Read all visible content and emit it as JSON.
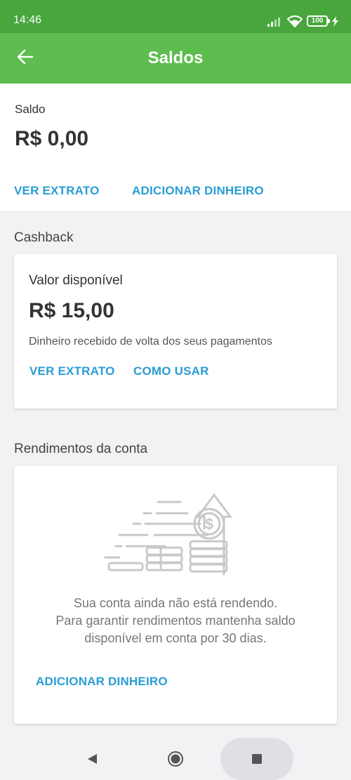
{
  "status_bar": {
    "time": "14:46",
    "battery": "100",
    "icons": [
      "signal-icon",
      "wifi-icon",
      "battery-icon",
      "charging-icon"
    ]
  },
  "app_bar": {
    "title": "Saldos",
    "back_icon": "arrow-left-icon"
  },
  "balance": {
    "label": "Saldo",
    "amount": "R$ 0,00",
    "statement_link": "VER EXTRATO",
    "add_money_link": "ADICIONAR DINHEIRO"
  },
  "cashback": {
    "section_title": "Cashback",
    "label": "Valor disponível",
    "amount": "R$ 15,00",
    "description": "Dinheiro recebido de volta dos seus pagamentos",
    "statement_link": "VER EXTRATO",
    "how_to_use_link": "COMO USAR"
  },
  "yield": {
    "section_title": "Rendimentos da conta",
    "illustration": "coins-growth-illustration",
    "message_line1": "Sua conta ainda não está rendendo.",
    "message_line2": "Para garantir rendimentos mantenha saldo",
    "message_line3": "disponível em conta por 30 dias.",
    "add_money_link": "ADICIONAR DINHEIRO"
  },
  "nav_bar": {
    "back": "triangle-back-icon",
    "home": "circle-home-icon",
    "recents": "square-recents-icon"
  },
  "colors": {
    "status_bar": "#48a63d",
    "app_bar": "#5dbd4e",
    "link": "#2a9dd4",
    "background": "#f1f2f4"
  }
}
